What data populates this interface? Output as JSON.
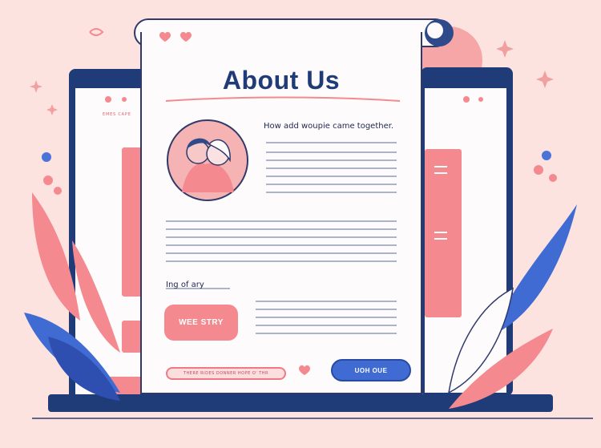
{
  "page": {
    "title": "About Us",
    "heading": "How add  woupie came together.",
    "section_label": "Ing of ary",
    "story_button": "WEE STRY",
    "outline_button": "THERE RIDES DONNER HOPE O' THR",
    "blue_button": "UOH OUE"
  },
  "left_panel": {
    "tab_label": "EMES CAPE"
  },
  "colors": {
    "background": "#fde3e0",
    "navy": "#1f3b78",
    "accent_pink": "#f48a8f",
    "accent_blue": "#3f6bd2"
  }
}
